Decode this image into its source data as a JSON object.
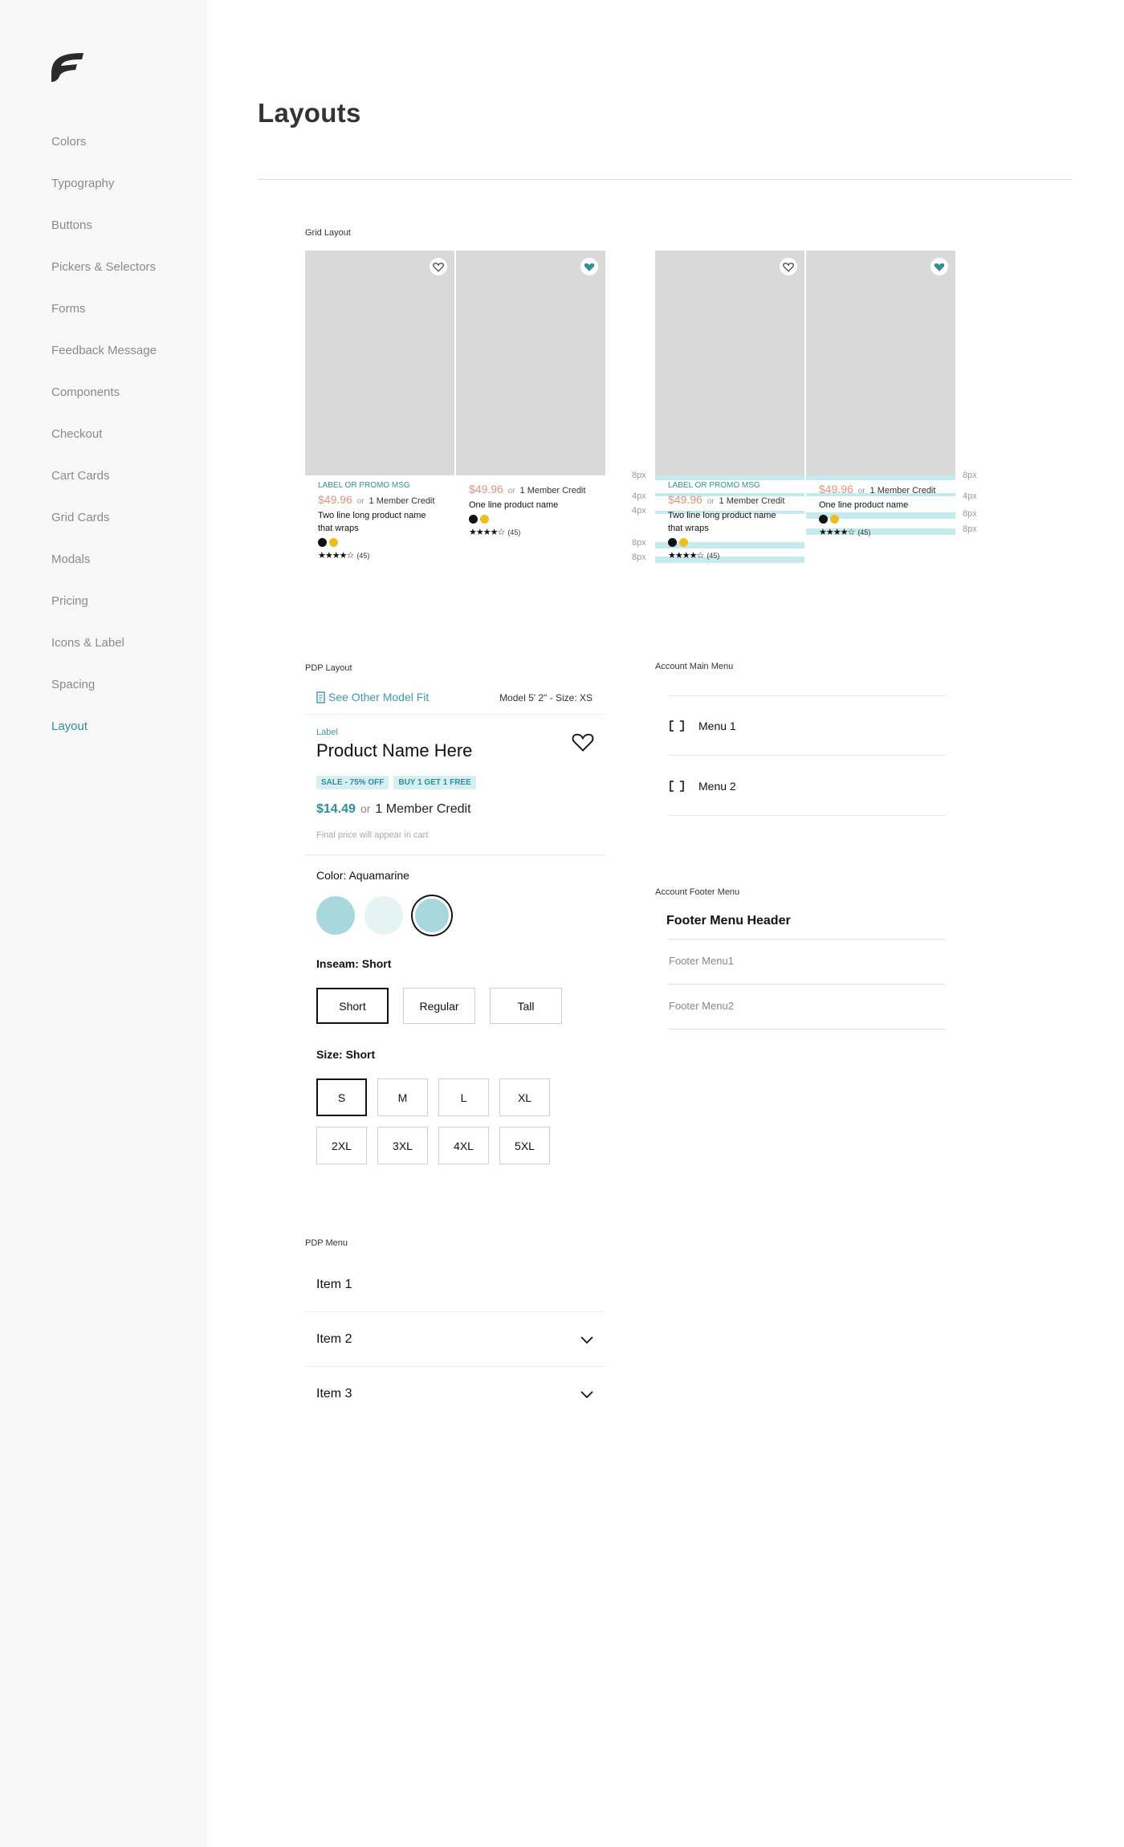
{
  "sidebar": {
    "items": [
      {
        "label": "Colors"
      },
      {
        "label": "Typography"
      },
      {
        "label": "Buttons"
      },
      {
        "label": "Pickers & Selectors"
      },
      {
        "label": "Forms"
      },
      {
        "label": "Feedback Message"
      },
      {
        "label": "Components"
      },
      {
        "label": "Checkout"
      },
      {
        "label": "Cart Cards"
      },
      {
        "label": "Grid Cards"
      },
      {
        "label": "Modals"
      },
      {
        "label": "Pricing"
      },
      {
        "label": "Icons & Label"
      },
      {
        "label": "Spacing"
      },
      {
        "label": "Layout"
      }
    ],
    "active": "Layout"
  },
  "page": {
    "title": "Layouts"
  },
  "grid_layout": {
    "label": "Grid Layout",
    "cards": [
      {
        "promo": "LABEL OR PROMO MSG",
        "price": "$49.96",
        "or": "or",
        "credit": "1 Member Credit",
        "name": "Two line long product name that wraps",
        "rating_count": "(45)",
        "heart": "outline"
      },
      {
        "promo": "",
        "price": "$49.96",
        "or": "or",
        "credit": "1 Member Credit",
        "name": "One line product name",
        "rating_count": "(45)",
        "heart": "filled"
      },
      {
        "promo": "LABEL OR PROMO MSG",
        "price": "$49.96",
        "or": "or",
        "credit": "1 Member Credit",
        "name": "Two line long product name that wraps",
        "rating_count": "(45)",
        "heart": "outline"
      },
      {
        "promo": "",
        "price": "$49.96",
        "or": "or",
        "credit": "1 Member Credit",
        "name": "One line product name",
        "rating_count": "(45)",
        "heart": "filled"
      }
    ],
    "stars": "★★★★☆",
    "annotations": {
      "px8": "8px",
      "px4": "4px"
    }
  },
  "pdp_layout": {
    "label": "PDP Layout",
    "see_fit": "See Other Model Fit",
    "model_info": "Model  5' 2\" - Size: XS",
    "product_label": "Label",
    "product_name": "Product Name Here",
    "badges": [
      "SALE - 75% OFF",
      "BUY 1 GET 1 FREE"
    ],
    "price": "$14.49",
    "or": "or",
    "credit": "1 Member Credit",
    "final_note": "Final price will appear in cart",
    "color_label": "Color: Aquamarine",
    "inseam_label": "Inseam: Short",
    "inseam_options": [
      "Short",
      "Regular",
      "Tall"
    ],
    "size_label": "Size: Short",
    "size_options": [
      "S",
      "M",
      "L",
      "XL",
      "2XL",
      "3XL",
      "4XL",
      "5XL"
    ],
    "selected_inseam": "Short",
    "selected_size": "S"
  },
  "account_main_menu": {
    "label": "Account Main Menu",
    "items": [
      "Menu 1",
      "Menu 2"
    ]
  },
  "account_footer_menu": {
    "label": "Account Footer Menu",
    "header": "Footer Menu Header",
    "items": [
      "Footer Menu1",
      "Footer Menu2"
    ]
  },
  "pdp_menu": {
    "label": "PDP Menu",
    "items": [
      "Item 1",
      "Item 2",
      "Item 3"
    ]
  },
  "colors": {
    "accent": "#2f8f9a",
    "price_orange": "#e0957a",
    "guide_cyan": "#c6ebef",
    "swatch_aqua": "#a8d8de",
    "swatch_light": "#e6f3f4"
  }
}
